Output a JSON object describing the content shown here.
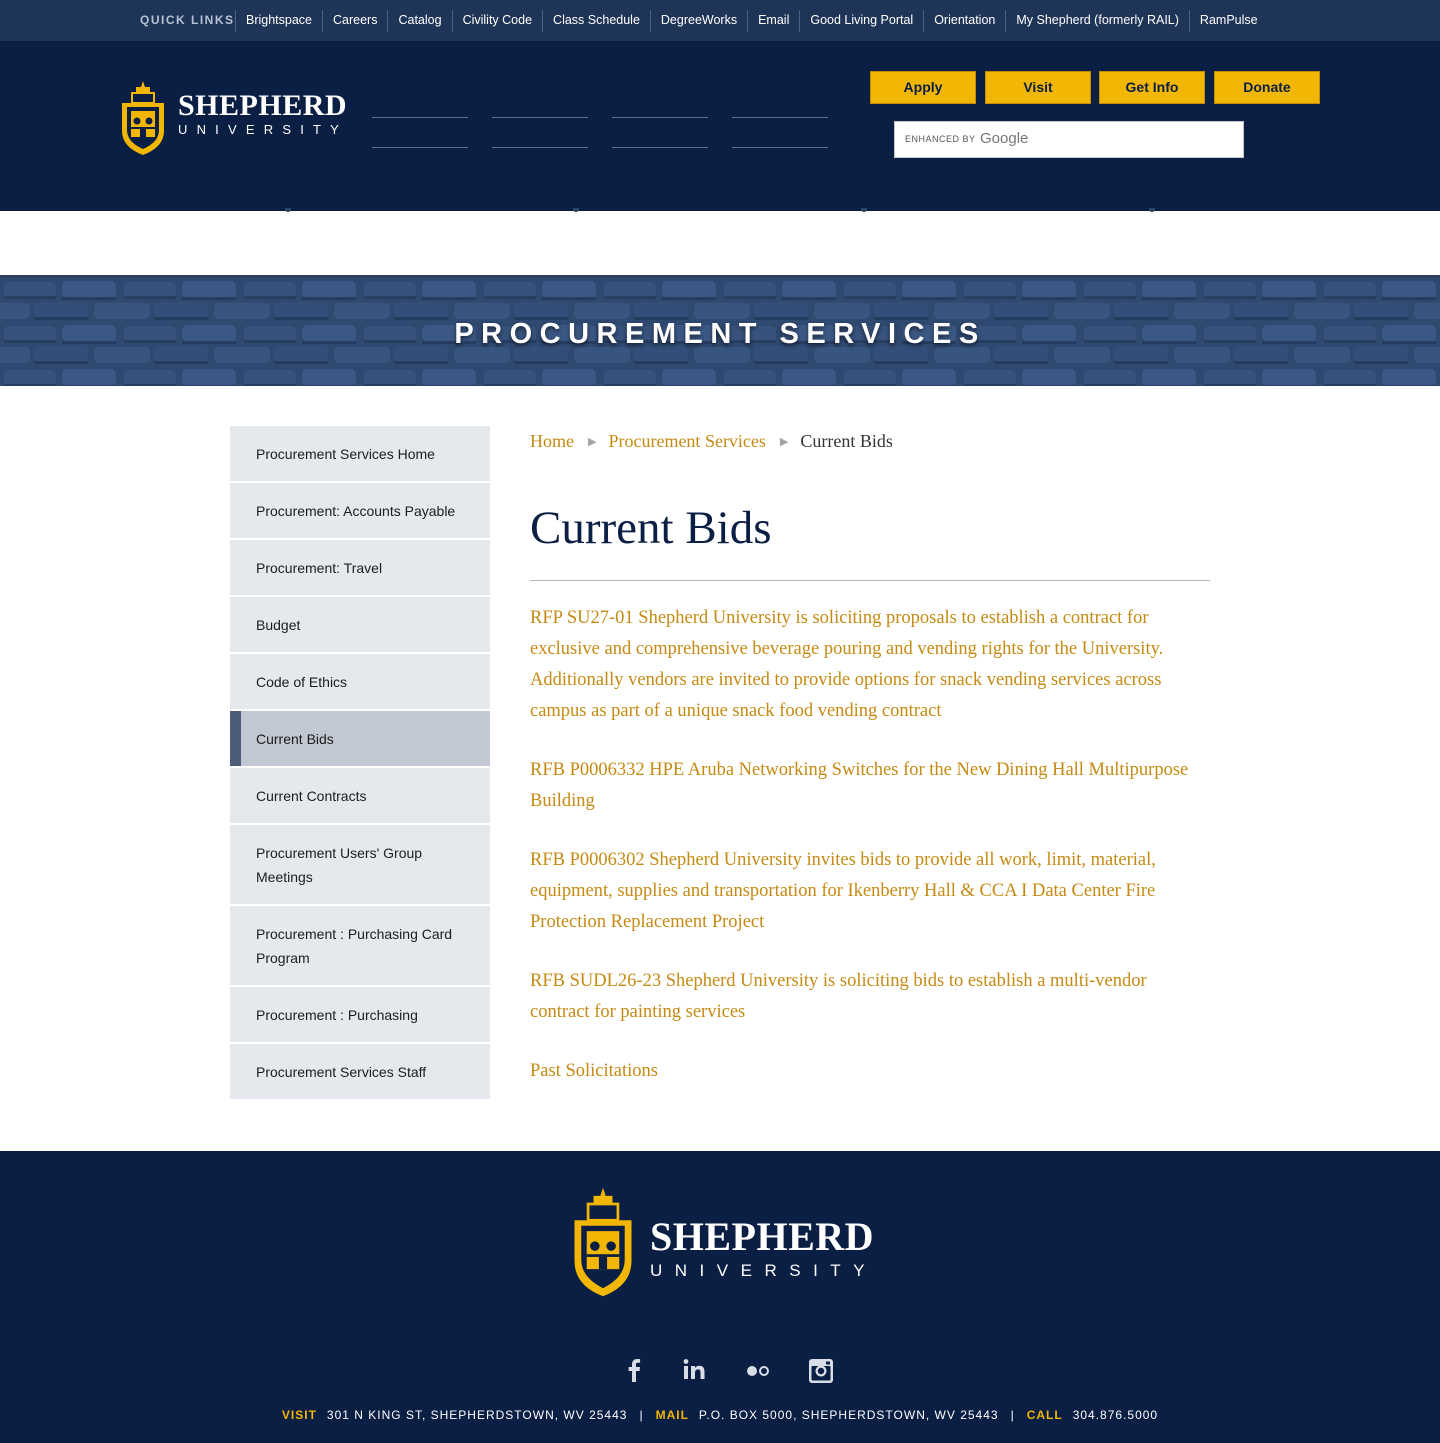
{
  "quick_links": {
    "title": "QUICK LINKS",
    "items": [
      "Brightspace",
      "Careers",
      "Catalog",
      "Civility Code",
      "Class Schedule",
      "DegreeWorks",
      "Email",
      "Good Living Portal",
      "Orientation",
      "My Shepherd (formerly RAIL)",
      "RamPulse"
    ]
  },
  "header": {
    "logo_line1": "SHEPHERD",
    "logo_line2": "UNIVERSITY",
    "buttons": [
      "Apply",
      "Visit",
      "Get Info",
      "Donate"
    ],
    "search": {
      "enhanced_label": "ENHANCED BY",
      "google_label": "Google",
      "value": ""
    }
  },
  "banner": {
    "title": "PROCUREMENT SERVICES"
  },
  "sidebar": {
    "items": [
      "Procurement Services Home",
      "Procurement: Accounts Payable",
      "Procurement: Travel",
      "Budget",
      "Code of Ethics",
      "Current Bids",
      "Current Contracts",
      "Procurement Users' Group Meetings",
      "Procurement : Purchasing Card Program",
      "Procurement : Purchasing",
      "Procurement Services Staff"
    ],
    "active": "Current Bids"
  },
  "breadcrumb": {
    "home": "Home",
    "parent": "Procurement Services",
    "current": "Current Bids",
    "separator": "▶"
  },
  "page": {
    "title": "Current Bids",
    "bids": [
      "RFP SU27-01 Shepherd University is soliciting proposals to establish a contract for exclusive and comprehensive beverage pouring and vending rights for the University. Additionally vendors are invited to provide options for snack vending services across campus as part of a unique snack food vending contract",
      "RFB P0006332 HPE Aruba Networking Switches for the New Dining Hall Multipurpose Building",
      "RFB P0006302 Shepherd University invites bids to provide all work, limit, material, equipment, supplies and transportation for Ikenberry Hall & CCA I Data Center Fire Protection Replacement Project",
      "RFB SUDL26-23 Shepherd University is soliciting bids to establish a multi-vendor contract for painting services",
      "Past Solicitations"
    ]
  },
  "footer": {
    "logo_line1": "SHEPHERD",
    "logo_line2": "UNIVERSITY",
    "social": [
      "facebook-icon",
      "linkedin-icon",
      "flickr-icon",
      "instagram-icon"
    ],
    "visit_label": "VISIT",
    "visit_value": "301 N KING ST, SHEPHERDSTOWN, WV 25443",
    "mail_label": "MAIL",
    "mail_value": "P.O. BOX 5000, SHEPHERDSTOWN, WV 25443",
    "call_label": "CALL",
    "call_value": "304.876.5000",
    "pipe": "|"
  },
  "colors": {
    "navy": "#0b1e44",
    "gold": "#f2b705",
    "link_gold": "#c58a12",
    "sidebar_bg": "#e5e8ed",
    "sidebar_active": "#c1c7d3"
  }
}
